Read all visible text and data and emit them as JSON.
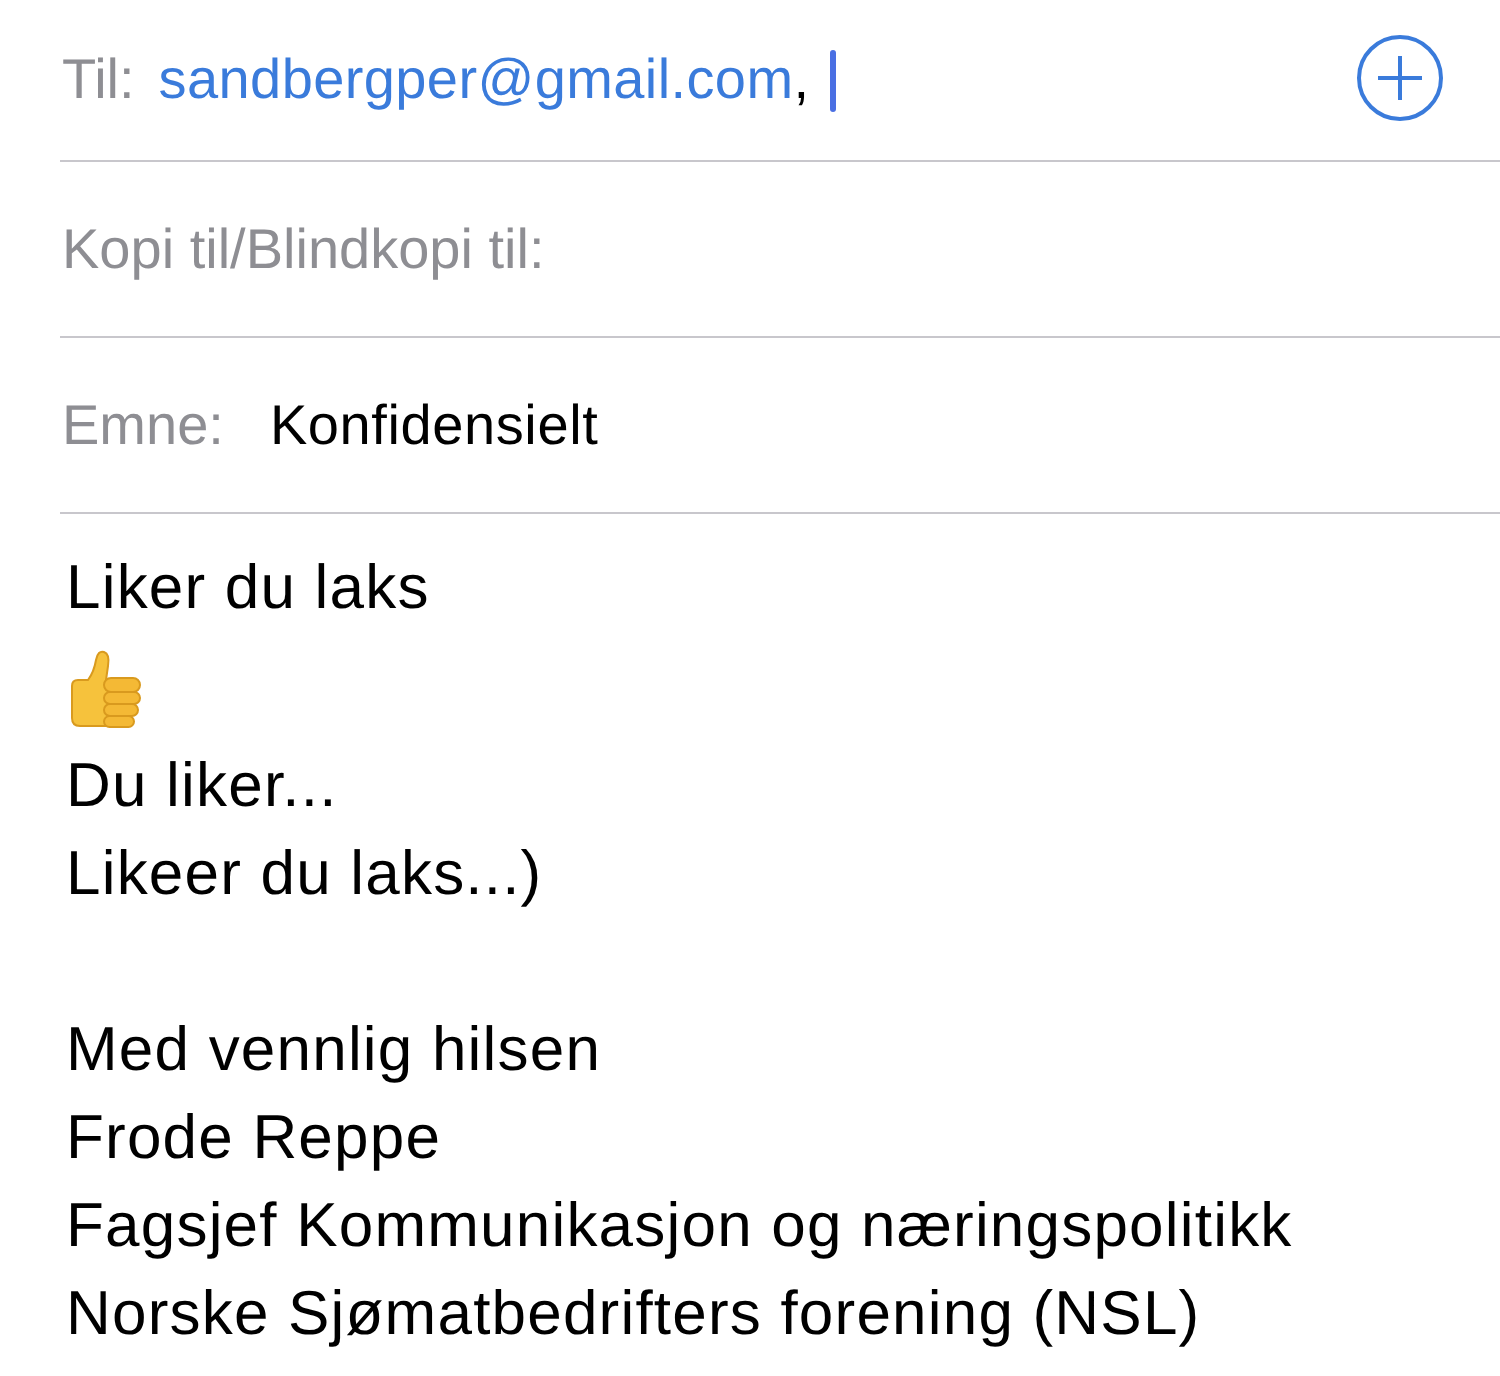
{
  "to": {
    "label": "Til:",
    "recipients": [
      {
        "address": "sandbergper@gmail.com"
      }
    ],
    "separator": ",",
    "focused": true
  },
  "cc_bcc": {
    "label": "Kopi til/Blindkopi til:"
  },
  "subject": {
    "label": "Emne:",
    "value": "Konfidensielt"
  },
  "body": {
    "lines": [
      {
        "kind": "text",
        "text": "Liker du laks"
      },
      {
        "kind": "emoji"
      },
      {
        "kind": "text",
        "text": "Du liker..."
      },
      {
        "kind": "text",
        "text": "Likeer du laks...)"
      },
      {
        "kind": "blank"
      },
      {
        "kind": "text",
        "text": "Med vennlig hilsen"
      },
      {
        "kind": "text",
        "text": "Frode Reppe"
      },
      {
        "kind": "text",
        "text": "Fagsjef Kommunikasjon og næringspolitikk"
      },
      {
        "kind": "text",
        "text": "Norske Sjømatbedrifters forening (NSL)"
      }
    ]
  }
}
